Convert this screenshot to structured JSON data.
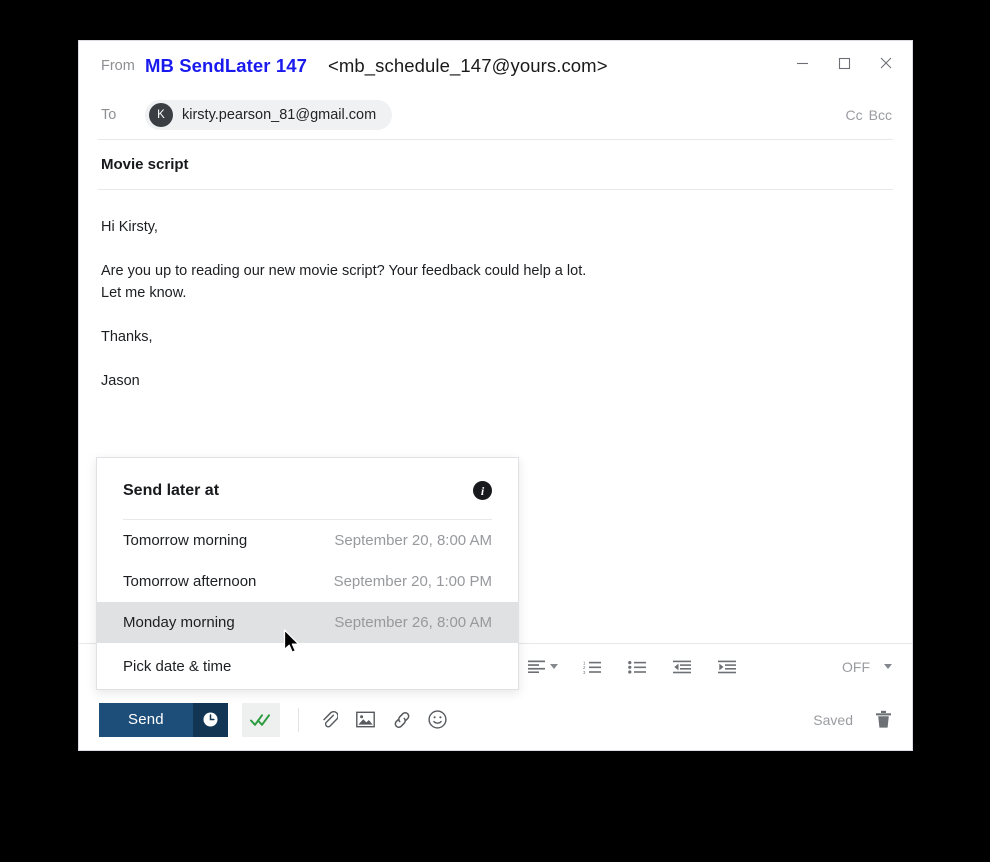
{
  "window": {
    "controls": {
      "minimize": "minimize-button",
      "maximize": "maximize-button",
      "close": "close-button"
    }
  },
  "header": {
    "from_label": "From",
    "from_name": "MB SendLater 147",
    "from_address": "<mb_schedule_147@yours.com>",
    "to_label": "To",
    "recipient_initial": "K",
    "recipient_email": "kirsty.pearson_81@gmail.com",
    "cc_label": "Cc",
    "bcc_label": "Bcc"
  },
  "subject": "Movie script",
  "body": {
    "paragraphs": [
      "Hi Kirsty,",
      "Are you up to reading our new movie script? Your feedback could help a lot.",
      "Let me know.",
      "Thanks,",
      "Jason"
    ]
  },
  "format_toolbar": {
    "align_label": "align-dropdown",
    "numbered_list_label": "numbered-list",
    "bulleted_list_label": "bulleted-list",
    "decrease_indent_label": "decrease-indent",
    "increase_indent_label": "increase-indent",
    "off_value": "OFF"
  },
  "send_bar": {
    "send_label": "Send",
    "schedule_icon": "clock-icon",
    "read_receipt_icon": "double-check-icon",
    "attach_icon": "paperclip-icon",
    "image_icon": "image-icon",
    "link_icon": "link-icon",
    "emoji_icon": "smiley-icon",
    "saved_label": "Saved",
    "delete_icon": "trash-icon"
  },
  "send_later_menu": {
    "title": "Send later at",
    "info_glyph": "i",
    "items": [
      {
        "label": "Tomorrow morning",
        "time": "September 20, 8:00 AM",
        "highlighted": false
      },
      {
        "label": "Tomorrow afternoon",
        "time": "September 20, 1:00 PM",
        "highlighted": false
      },
      {
        "label": "Monday morning",
        "time": "September 26, 8:00 AM",
        "highlighted": true
      },
      {
        "label": "Pick date & time",
        "time": "",
        "highlighted": false
      }
    ]
  },
  "colors": {
    "send_button": "#1d4e79",
    "send_clock": "#123553",
    "from_name": "#1a1aee",
    "read_receipt_check": "#2d9b3f",
    "highlight_row": "#e0e1e2"
  }
}
